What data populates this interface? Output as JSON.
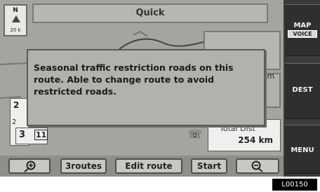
{
  "compass": {
    "north": "N",
    "scale": "20 k"
  },
  "top": {
    "route_type": "Quick"
  },
  "popup": {
    "message": "Seasonal traffic restriction roads on this\nroute.  Able to change route to avoid\nrestricted roads."
  },
  "map": {
    "distance_unit": "km",
    "left_values": {
      "top": "2",
      "bottom": "2"
    },
    "time": {
      "hours": "3",
      "minutes": "11"
    },
    "total": {
      "label": "Total Dist",
      "value": "254 km"
    }
  },
  "sidebar": {
    "map_label": "MAP",
    "voice_label": "VOICE",
    "dest_label": "DEST",
    "menu_label": "MENU"
  },
  "buttons": {
    "routes": "3routes",
    "edit_route": "Edit route",
    "start": "Start"
  },
  "footer": {
    "code": "L00150"
  }
}
